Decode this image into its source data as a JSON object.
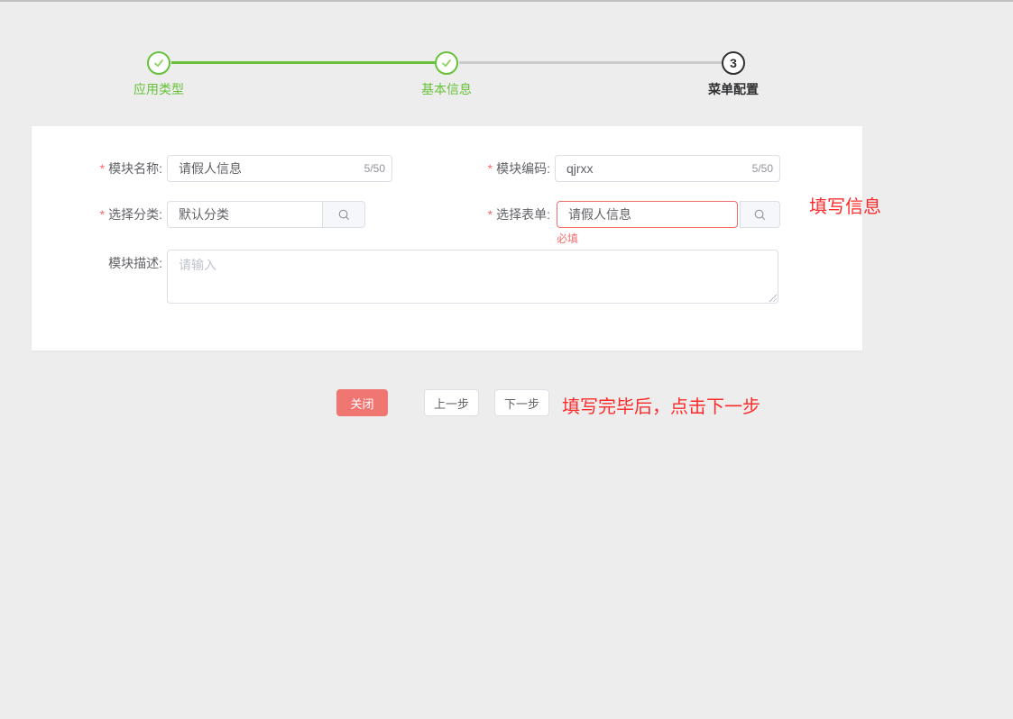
{
  "stepper": {
    "steps": [
      {
        "label": "应用类型",
        "status": "done"
      },
      {
        "label": "基本信息",
        "status": "done"
      },
      {
        "label": "菜单配置",
        "status": "current",
        "number": "3"
      }
    ]
  },
  "form": {
    "required_mark": "*",
    "module_name": {
      "label": "模块名称:",
      "value": "请假人信息",
      "counter": "5/50"
    },
    "module_code": {
      "label": "模块编码:",
      "value": "qjrxx",
      "counter": "5/50"
    },
    "category": {
      "label": "选择分类:",
      "value": "默认分类"
    },
    "form_select": {
      "label": "选择表单:",
      "value": "请假人信息",
      "error": "必填"
    },
    "module_desc": {
      "label": "模块描述:",
      "placeholder": "请输入"
    }
  },
  "footer": {
    "close_label": "关闭",
    "prev_label": "上一步",
    "next_label": "下一步"
  },
  "annotations": {
    "fill_info": "填写信息",
    "after_fill": "填写完毕后，点击下一步"
  },
  "colors": {
    "success_green": "#67c23a",
    "error_red": "#f56c6c",
    "close_button_red": "#f07672",
    "annotation_red": "#fc2b2b",
    "page_background": "#ededed"
  }
}
